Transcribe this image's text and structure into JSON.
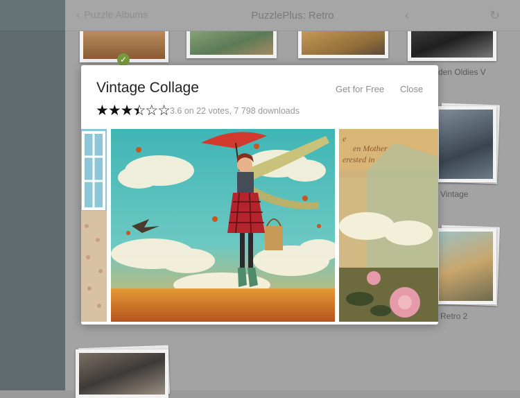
{
  "topbar": {
    "title": "PuzzlePlus: Retro",
    "back_label": "Puzzle Albums",
    "back_chevron": "‹",
    "nav_icon": "‹",
    "refresh_icon": "↻"
  },
  "grid_labels": {
    "golden_oldies": "den Oldies V",
    "vintage": "Vintage",
    "retro2": "Retro 2"
  },
  "check_mark": "✓",
  "modal": {
    "title": "Vintage Collage",
    "get_label": "Get for Free",
    "close_label": "Close",
    "rating_value": 3.6,
    "stars_full": "★★★",
    "star_half": "★",
    "star_half_bg": "☆",
    "stars_empty": "☆☆",
    "rating_text": "3.6 on 22 votes, 7 798 downloads"
  },
  "colors": {
    "sidebar": "#5f6b6c",
    "check": "#7a9a3f",
    "umbrella": "#d33a2e",
    "sky": "#3fb5b5"
  }
}
